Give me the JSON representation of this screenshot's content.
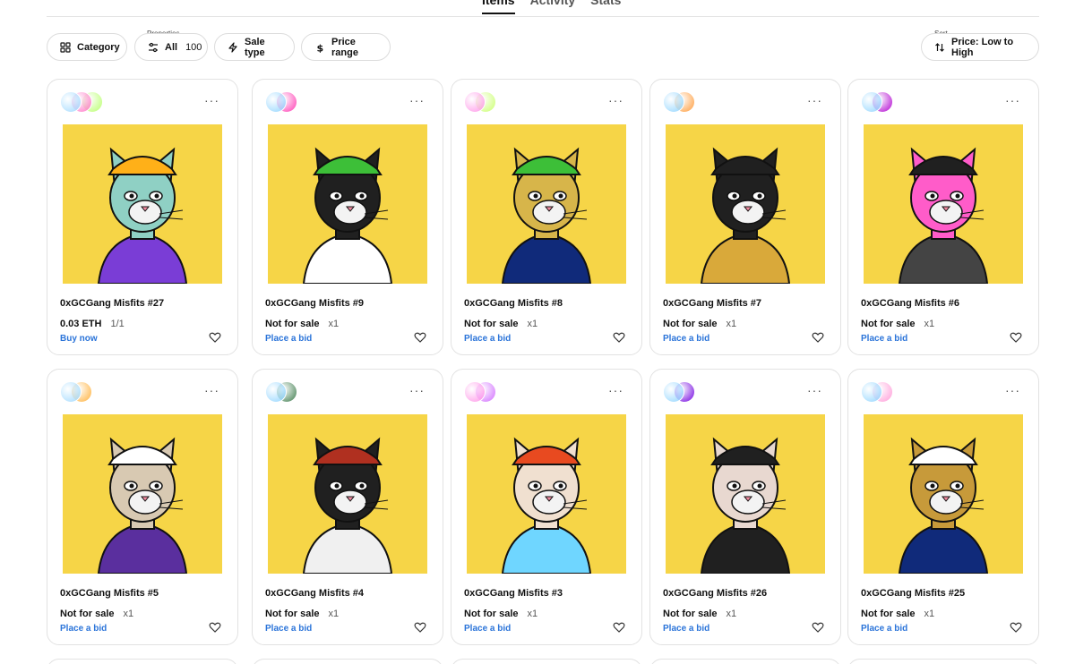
{
  "tabs": [
    {
      "label": "Items",
      "active": true
    },
    {
      "label": "Activity",
      "active": false
    },
    {
      "label": "Stats",
      "active": false
    }
  ],
  "filters": {
    "category_label": "Category",
    "properties_caption": "Properties",
    "properties_value": "All",
    "properties_count": "100",
    "sale_type_label": "Sale type",
    "price_range_label": "Price range",
    "sort_caption": "Sort",
    "sort_value": "Price: Low to High"
  },
  "colors": {
    "art_background": "#f6d547",
    "link_blue": "#2b74d9",
    "border": "#e2e2e2"
  },
  "cards": [
    {
      "title": "0xGCGang Misfits #27",
      "price": "0.03 ETH",
      "edition": "1/1",
      "action": "Buy now",
      "fur": "#8fd0c4",
      "outfit": "#7a3dd6",
      "accent": "#ffb018",
      "avatars": [
        "#9fd9ff",
        "#ff74c6",
        "#b8ff6b"
      ]
    },
    {
      "title": "0xGCGang Misfits #9",
      "price": "Not for sale",
      "edition": "x1",
      "action": "Place a bid",
      "fur": "#202020",
      "outfit": "#ffffff",
      "accent": "#3dbf38",
      "avatars": [
        "#8fd4ff",
        "#ff38b2"
      ]
    },
    {
      "title": "0xGCGang Misfits #8",
      "price": "Not for sale",
      "edition": "x1",
      "action": "Place a bid",
      "fur": "#d7b54a",
      "outfit": "#102a7a",
      "accent": "#3dbf38",
      "avatars": [
        "#ff94e8",
        "#c9ff6b"
      ]
    },
    {
      "title": "0xGCGang Misfits #7",
      "price": "Not for sale",
      "edition": "x1",
      "action": "Place a bid",
      "fur": "#202020",
      "outfit": "#d9a93a",
      "accent": "#202020",
      "avatars": [
        "#8fd4ff",
        "#ff9a38"
      ]
    },
    {
      "title": "0xGCGang Misfits #6",
      "price": "Not for sale",
      "edition": "x1",
      "action": "Place a bid",
      "fur": "#ff5cc9",
      "outfit": "#444444",
      "accent": "#202020",
      "avatars": [
        "#8fd4ff",
        "#b000d0"
      ]
    },
    {
      "title": "0xGCGang Misfits #5",
      "price": "Not for sale",
      "edition": "x1",
      "action": "Place a bid",
      "fur": "#d8c9b2",
      "outfit": "#5a2f9e",
      "accent": "#ffffff",
      "avatars": [
        "#9fd9ff",
        "#ffb038"
      ]
    },
    {
      "title": "0xGCGang Misfits #4",
      "price": "Not for sale",
      "edition": "x1",
      "action": "Place a bid",
      "fur": "#202020",
      "outfit": "#f0f0f0",
      "accent": "#b03020",
      "avatars": [
        "#8fd4ff",
        "#3a7a4a"
      ]
    },
    {
      "title": "0xGCGang Misfits #3",
      "price": "Not for sale",
      "edition": "x1",
      "action": "Place a bid",
      "fur": "#f0e0d0",
      "outfit": "#6fd6ff",
      "accent": "#e84a20",
      "avatars": [
        "#ff94e8",
        "#d16bff"
      ]
    },
    {
      "title": "0xGCGang Misfits #26",
      "price": "Not for sale",
      "edition": "x1",
      "action": "Place a bid",
      "fur": "#e8d8d0",
      "outfit": "#202020",
      "accent": "#202020",
      "avatars": [
        "#8fd4ff",
        "#7000e0"
      ]
    },
    {
      "title": "0xGCGang Misfits #25",
      "price": "Not for sale",
      "edition": "x1",
      "action": "Place a bid",
      "fur": "#c79a3a",
      "outfit": "#102a7a",
      "accent": "#ffffff",
      "avatars": [
        "#8fd4ff",
        "#ff9ad8"
      ]
    }
  ]
}
